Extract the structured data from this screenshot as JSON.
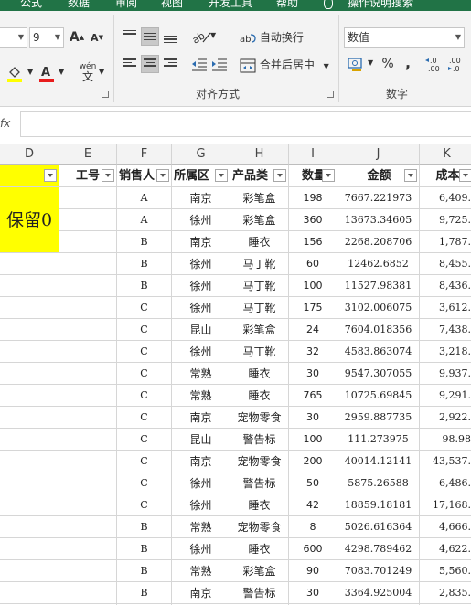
{
  "ribbon_tabs": [
    "公式",
    "数据",
    "审阅",
    "视图",
    "开发工具",
    "帮助",
    "操作说明搜索"
  ],
  "font": {
    "size": "9"
  },
  "icons": {
    "increase_font": "A",
    "decrease_font": "A",
    "wen_label": "wén",
    "wen_char": "文",
    "percent": "%",
    "comma": ",",
    "inc_decimal": "←.0\n.00",
    "dec_decimal": ".00\n→.0"
  },
  "alignment": {
    "wrap_text": "自动换行",
    "merge_center": "合并后居中",
    "group_label": "对齐方式"
  },
  "number": {
    "format": "数值",
    "group_label": "数字"
  },
  "formula_bar": {
    "fx": "fx",
    "value": ""
  },
  "columns": [
    "D",
    "E",
    "F",
    "G",
    "H",
    "I",
    "J",
    "K"
  ],
  "headers": [
    "",
    "工号",
    "销售人",
    "所属区",
    "产品类",
    "数量",
    "金额",
    "成本"
  ],
  "merged_cell": "保留0",
  "rows": [
    [
      "A",
      "南京",
      "彩笔盒",
      "198",
      "7667.221973",
      "6,409."
    ],
    [
      "A",
      "徐州",
      "彩笔盒",
      "360",
      "13673.34605",
      "9,725."
    ],
    [
      "B",
      "南京",
      "睡衣",
      "156",
      "2268.208706",
      "1,787."
    ],
    [
      "B",
      "徐州",
      "马丁靴",
      "60",
      "12462.6852",
      "8,455."
    ],
    [
      "B",
      "徐州",
      "马丁靴",
      "100",
      "11527.98381",
      "8,436."
    ],
    [
      "C",
      "徐州",
      "马丁靴",
      "175",
      "3102.006075",
      "3,612."
    ],
    [
      "C",
      "昆山",
      "彩笔盒",
      "24",
      "7604.018356",
      "7,438."
    ],
    [
      "C",
      "徐州",
      "马丁靴",
      "32",
      "4583.863074",
      "3,218."
    ],
    [
      "C",
      "常熟",
      "睡衣",
      "30",
      "9547.307055",
      "9,937."
    ],
    [
      "C",
      "常熟",
      "睡衣",
      "765",
      "10725.69845",
      "9,291."
    ],
    [
      "C",
      "南京",
      "宠物零食",
      "30",
      "2959.887735",
      "2,922."
    ],
    [
      "C",
      "昆山",
      "警告标",
      "100",
      "111.273975",
      "98.98"
    ],
    [
      "C",
      "南京",
      "宠物零食",
      "200",
      "40014.12141",
      "43,537."
    ],
    [
      "C",
      "徐州",
      "警告标",
      "50",
      "5875.26588",
      "6,486."
    ],
    [
      "C",
      "徐州",
      "睡衣",
      "42",
      "18859.18181",
      "17,168."
    ],
    [
      "B",
      "常熟",
      "宠物零食",
      "8",
      "5026.616364",
      "4,666."
    ],
    [
      "B",
      "徐州",
      "睡衣",
      "600",
      "4298.789462",
      "4,622."
    ],
    [
      "B",
      "常熟",
      "彩笔盒",
      "90",
      "7083.701249",
      "5,560."
    ],
    [
      "B",
      "南京",
      "警告标",
      "30",
      "3364.925004",
      "2,835."
    ]
  ]
}
